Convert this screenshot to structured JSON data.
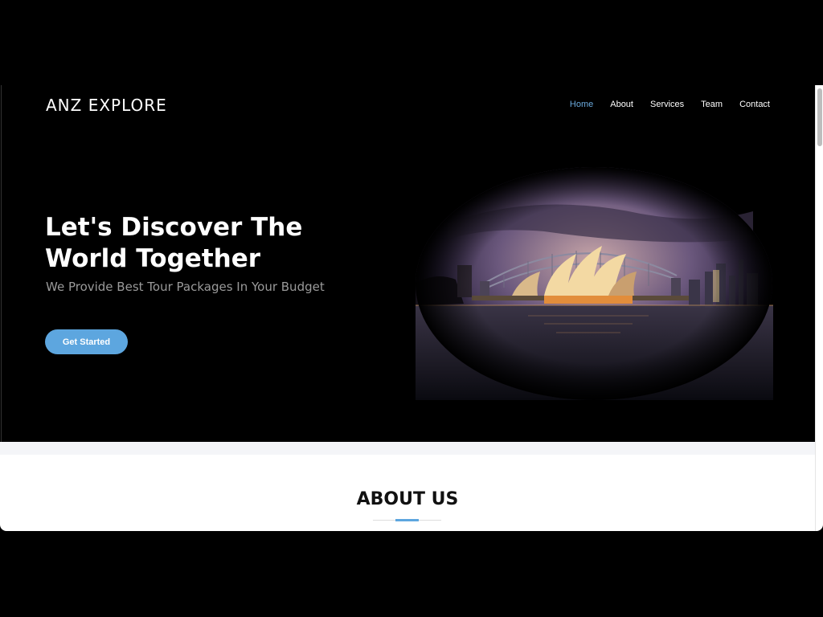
{
  "brand": {
    "name": "ANZ EXPLORE"
  },
  "nav": {
    "items": [
      {
        "label": "Home",
        "active": true
      },
      {
        "label": "About",
        "active": false
      },
      {
        "label": "Services",
        "active": false
      },
      {
        "label": "Team",
        "active": false
      },
      {
        "label": "Contact",
        "active": false
      }
    ]
  },
  "hero": {
    "headline": "Let's Discover The World Together",
    "subheadline": "We Provide Best Tour Packages In Your Budget",
    "cta_label": "Get Started",
    "image_subject": "sydney-opera-house-night"
  },
  "about": {
    "title": "ABOUT US"
  },
  "colors": {
    "accent": "#5da6df",
    "nav_active": "#6aa9dc",
    "background": "#000000",
    "subtext": "#9a9a9a"
  }
}
